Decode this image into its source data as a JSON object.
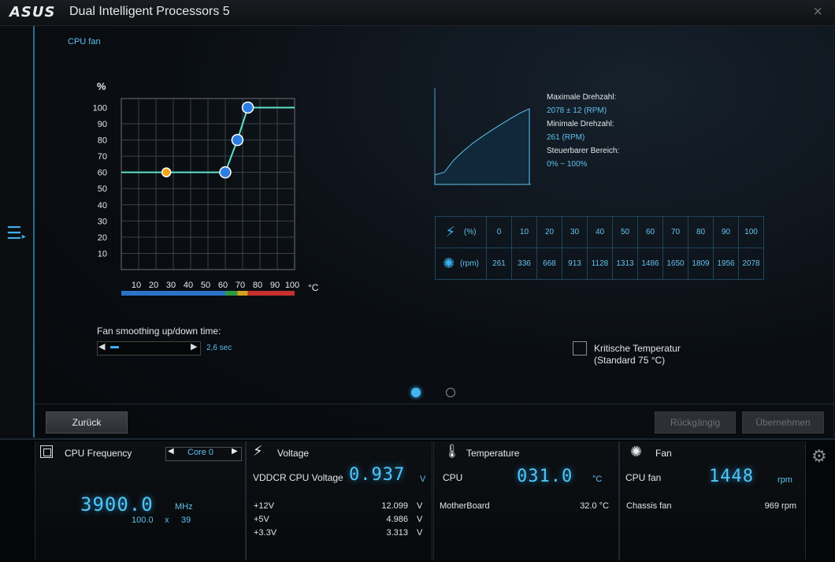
{
  "window": {
    "brand": "ASUS",
    "title": "Dual Intelligent Processors 5",
    "close": "×"
  },
  "section_title": "CPU fan",
  "fan_curve": {
    "y_unit": "%",
    "x_unit": "°C",
    "y_ticks": [
      "100",
      "90",
      "80",
      "70",
      "60",
      "50",
      "40",
      "30",
      "20",
      "10"
    ],
    "x_ticks": [
      "10",
      "20",
      "30",
      "40",
      "50",
      "60",
      "70",
      "80",
      "90",
      "100"
    ],
    "points": [
      {
        "temp": 0,
        "pct": 60
      },
      {
        "temp": 26,
        "pct": 60
      },
      {
        "temp": 60,
        "pct": 60
      },
      {
        "temp": 67,
        "pct": 80
      },
      {
        "temp": 73,
        "pct": 100
      },
      {
        "temp": 100,
        "pct": 100
      }
    ],
    "handles": [
      {
        "temp": 26,
        "pct": 60,
        "color": "#f2a516"
      },
      {
        "temp": 60,
        "pct": 60,
        "color": "#2b7de0"
      },
      {
        "temp": 67,
        "pct": 80,
        "color": "#2b7de0"
      },
      {
        "temp": 73,
        "pct": 100,
        "color": "#2b7de0"
      }
    ],
    "zones": [
      {
        "from": 0,
        "to": 60,
        "color": "#2b73c9"
      },
      {
        "from": 60,
        "to": 67,
        "color": "#2f9a44"
      },
      {
        "from": 67,
        "to": 73,
        "color": "#d4a21c"
      },
      {
        "from": 73,
        "to": 100,
        "color": "#c5312d"
      }
    ],
    "line_color": "#5ee3c8"
  },
  "rpm_stats": {
    "max_label": "Maximale Drehzahl:",
    "max_value": "2078 ± 12 (RPM)",
    "min_label": "Minimale Drehzahl:",
    "min_value": "261 (RPM)",
    "range_label": "Steuerbarer Bereich:",
    "range_value": "0% ~ 100%"
  },
  "rpm_table": {
    "pct_unit": "(%)",
    "rpm_unit": "(rpm)",
    "percents": [
      "0",
      "10",
      "20",
      "30",
      "40",
      "50",
      "60",
      "70",
      "80",
      "90",
      "100"
    ],
    "rpms": [
      "261",
      "336",
      "668",
      "913",
      "1128",
      "1313",
      "1486",
      "1650",
      "1809",
      "1956",
      "2078"
    ]
  },
  "smoothing": {
    "label": "Fan smoothing up/down time:",
    "value": "2,6 sec",
    "level": 0.15
  },
  "critical": {
    "label": "Kritische Temperatur",
    "sub": "(Standard 75 °C)",
    "checked": false
  },
  "buttons": {
    "back": "Zurück",
    "undo": "Rückgängig",
    "apply": "Übernehmen"
  },
  "bottom": {
    "cpu": {
      "title": "CPU Frequency",
      "core": "Core 0",
      "freq": "3900.0",
      "freq_unit": "MHz",
      "base": "100.0",
      "x": "x",
      "mult": "39"
    },
    "voltage": {
      "title": "Voltage",
      "main_label": "VDDCR CPU Voltage",
      "main_value": "0.937",
      "main_unit": "V",
      "rows": [
        {
          "label": "+12V",
          "value": "12.099",
          "unit": "V"
        },
        {
          "label": "+5V",
          "value": "4.986",
          "unit": "V"
        },
        {
          "label": "+3.3V",
          "value": "3.313",
          "unit": "V"
        }
      ]
    },
    "temperature": {
      "title": "Temperature",
      "cpu_label": "CPU",
      "cpu_value": "031.0",
      "cpu_unit": "°C",
      "mb_label": "MotherBoard",
      "mb_value": "32.0 °C"
    },
    "fan": {
      "title": "Fan",
      "cpu_label": "CPU fan",
      "cpu_value": "1448",
      "cpu_unit": "rpm",
      "chassis_label": "Chassis fan",
      "chassis_value": "969 rpm"
    }
  }
}
